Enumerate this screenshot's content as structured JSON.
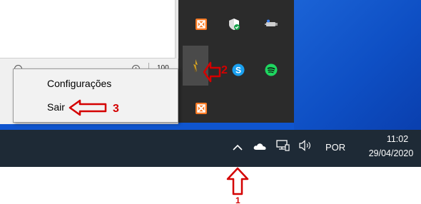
{
  "app_window": {
    "zoom_level": "100"
  },
  "context_menu": {
    "items": [
      {
        "label": "Configurações"
      },
      {
        "label": "Sair"
      }
    ]
  },
  "tray_flyout": {
    "icons": [
      {
        "name": "xampp-icon"
      },
      {
        "name": "windows-security-icon"
      },
      {
        "name": "usb-safely-remove-icon"
      },
      {
        "name": "app-tray-icon"
      },
      {
        "name": "skype-icon"
      },
      {
        "name": "spotify-icon"
      },
      {
        "name": "xampp-icon"
      }
    ]
  },
  "taskbar": {
    "language": "POR",
    "time": "11:02",
    "date": "29/04/2020"
  },
  "annotations": {
    "step1": "1",
    "step2": "2",
    "step3": "3"
  },
  "colors": {
    "annotation_red": "#d40000",
    "taskbar": "#1e2a36",
    "flyout": "#2b2b2b",
    "desktop_blue": "#1b63d6"
  }
}
